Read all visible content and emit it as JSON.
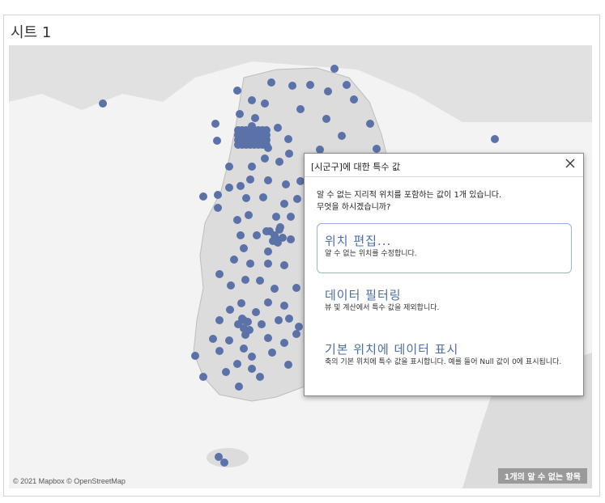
{
  "sheet": {
    "title": "시트 1"
  },
  "map": {
    "attribution": "© 2021 Mapbox © OpenStreetMap",
    "unknown_badge": "1개의 알 수 없는 항목",
    "marker_color": "#5a72a8"
  },
  "dialog": {
    "title": "[시군구]에 대한 특수 값",
    "message": "알 수 없는 지리적 위치를 포함하는 값이 1개 있습니다.\n무엇을 하시겠습니까?",
    "options": [
      {
        "title": "위치 편집...",
        "desc": "알 수 없는 위치를 수정합니다."
      },
      {
        "title": "데이터 필터링",
        "desc": "뷰 및 계산에서 특수 값을 제외합니다."
      },
      {
        "title": "기본 위치에 데이터 표시",
        "desc": "축의 기본 위치에 특수 값을 표시합니다. 예를 들어 Null 값이 0에 표시됩니다."
      }
    ]
  }
}
